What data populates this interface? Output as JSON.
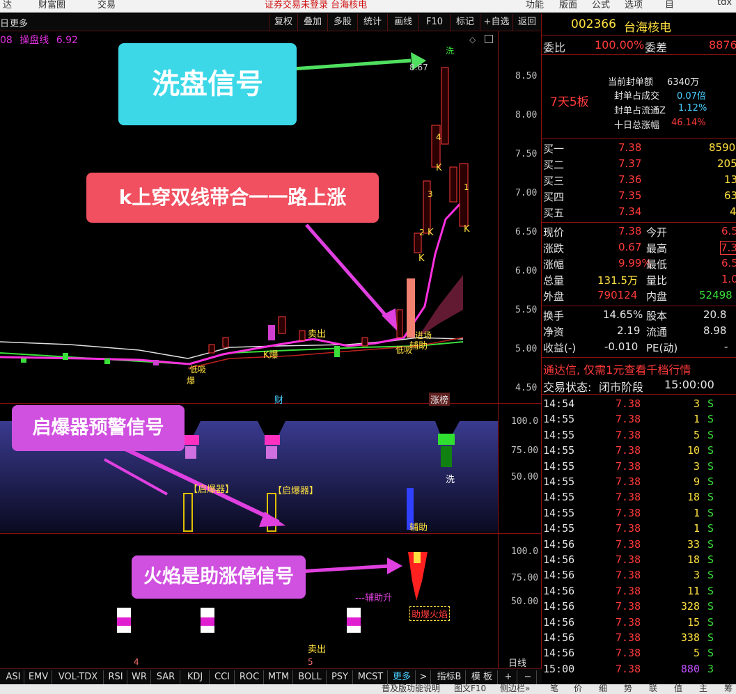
{
  "topmenu": {
    "items": [
      "达",
      "财富圈",
      "交易"
    ],
    "notice": "证券交易未登录  台海核电",
    "right_items": [
      "功能",
      "版面",
      "公式",
      "选项",
      "目",
      "tdx"
    ]
  },
  "toolbar": {
    "period": "日",
    "more": "更多",
    "buttons": [
      "复权",
      "叠加",
      "多股",
      "统计",
      "画线",
      "F10",
      "标记",
      "+自选",
      "返回"
    ]
  },
  "indicator": {
    "code": "08",
    "name": "操盘线",
    "value": "6.92"
  },
  "price_axis": [
    "8.50",
    "8.00",
    "7.50",
    "7.00",
    "6.50",
    "6.00",
    "5.50",
    "5.00",
    "4.50"
  ],
  "panel2_axis": [
    "100.0",
    "75.00",
    "50.00"
  ],
  "panel3_axis": [
    "100.0",
    "75.00",
    "50.00"
  ],
  "callouts": {
    "wash": "洗盘信号",
    "k_cross": "k上穿双线带合一一路上涨",
    "detonator": "启爆器预警信号",
    "flame": "火焰是助涨停信号"
  },
  "chart_labels": {
    "peak": "8.67",
    "wash_top": "洗",
    "k": "K",
    "k_bao": "K爆",
    "low_suck_1": "低吸",
    "low_suck_2": "低吸",
    "enter": "进场",
    "assist": "辅助",
    "sell": "卖出",
    "bao": "爆",
    "cai": "财",
    "zhangbang": "涨榜",
    "wave_1": "1",
    "wave_2": "2",
    "wave_3": "3",
    "wave_4": "4",
    "detonator_1": "【启爆器】",
    "detonator_2": "【启爆器】",
    "wash_p2": "洗",
    "assist_p2": "辅助",
    "assist_up": "---辅助升",
    "flame": "助爆火焰",
    "sell_p3": "卖出",
    "day_4": "4",
    "day_5": "5",
    "day_line": "日线"
  },
  "stock": {
    "code": "002366",
    "name": "台海核电"
  },
  "weibi": {
    "label1": "委比",
    "value1": "100.00%",
    "label2": "委差",
    "value2": "8876"
  },
  "board": {
    "streak": "7天5板",
    "rows": [
      {
        "label": "当前封单额",
        "value": "6340万"
      },
      {
        "label": "封单占成交",
        "value": "0.07倍"
      },
      {
        "label": "封单占流通Z",
        "value": "1.12%"
      },
      {
        "label": "十日总涨幅",
        "value": "46.14%"
      }
    ]
  },
  "orderbook": [
    {
      "label": "买一",
      "price": "7.38",
      "vol": "8590"
    },
    {
      "label": "买二",
      "price": "7.37",
      "vol": "205"
    },
    {
      "label": "买三",
      "price": "7.36",
      "vol": "13"
    },
    {
      "label": "买四",
      "price": "7.35",
      "vol": "63"
    },
    {
      "label": "买五",
      "price": "7.34",
      "vol": "4"
    }
  ],
  "quote": [
    {
      "l1": "现价",
      "v1": "7.38",
      "l2": "今开",
      "v2": "6.5"
    },
    {
      "l1": "涨跌",
      "v1": "0.67",
      "l2": "最高",
      "v2": "7.3"
    },
    {
      "l1": "涨幅",
      "v1": "9.99%",
      "l2": "最低",
      "v2": "6.5"
    },
    {
      "l1": "总量",
      "v1": "131.5万",
      "l2": "量比",
      "v2": "1.0"
    },
    {
      "l1": "外盘",
      "v1": "790124",
      "l2": "内盘",
      "v2": "52498"
    }
  ],
  "fundamentals": [
    {
      "l1": "换手",
      "v1": "14.65%",
      "l2": "股本",
      "v2": "20.8"
    },
    {
      "l1": "净资",
      "v1": "2.19",
      "l2": "流通",
      "v2": "8.98"
    },
    {
      "l1": "收益(-)",
      "v1": "-0.010",
      "l2": "PE(动)",
      "v2": "-"
    }
  ],
  "promo": "通达信, 仅需1元查看千档行情",
  "trade_status": {
    "label": "交易状态:",
    "value": "闭市阶段",
    "time": "15:00:00"
  },
  "ticks": [
    {
      "t": "14:54",
      "p": "7.38",
      "v": "3",
      "s": "S"
    },
    {
      "t": "14:55",
      "p": "7.38",
      "v": "1",
      "s": "S"
    },
    {
      "t": "14:55",
      "p": "7.38",
      "v": "5",
      "s": "S"
    },
    {
      "t": "14:55",
      "p": "7.38",
      "v": "10",
      "s": "S"
    },
    {
      "t": "14:55",
      "p": "7.38",
      "v": "3",
      "s": "S"
    },
    {
      "t": "14:55",
      "p": "7.38",
      "v": "9",
      "s": "S"
    },
    {
      "t": "14:55",
      "p": "7.38",
      "v": "18",
      "s": "S"
    },
    {
      "t": "14:55",
      "p": "7.38",
      "v": "1",
      "s": "S"
    },
    {
      "t": "14:55",
      "p": "7.38",
      "v": "1",
      "s": "S"
    },
    {
      "t": "14:56",
      "p": "7.38",
      "v": "33",
      "s": "S"
    },
    {
      "t": "14:56",
      "p": "7.38",
      "v": "18",
      "s": "S"
    },
    {
      "t": "14:56",
      "p": "7.38",
      "v": "3",
      "s": "S"
    },
    {
      "t": "14:56",
      "p": "7.38",
      "v": "11",
      "s": "S"
    },
    {
      "t": "14:56",
      "p": "7.38",
      "v": "328",
      "s": "S"
    },
    {
      "t": "14:56",
      "p": "7.38",
      "v": "15",
      "s": "S"
    },
    {
      "t": "14:56",
      "p": "7.38",
      "v": "338",
      "s": "S"
    },
    {
      "t": "14:56",
      "p": "7.38",
      "v": "5",
      "s": "S"
    },
    {
      "t": "15:00",
      "p": "7.38",
      "v": "880",
      "s": "3"
    }
  ],
  "bottom_tabs": [
    "ASI",
    "EMV",
    "VOL-TDX",
    "RSI",
    "WR",
    "SAR",
    "KDJ",
    "CCI",
    "ROC",
    "MTM",
    "BOLL",
    "PSY",
    "MCST",
    "更多",
    ">",
    "指标B",
    "模 板",
    "+",
    "−"
  ],
  "statusbar": {
    "left": "普及版功能说明",
    "mid": "图文F10",
    "mid2": "侧边栏»",
    "right_tabs": [
      "笔",
      "价",
      "细",
      "势",
      "联",
      "值",
      "主",
      "筹"
    ]
  },
  "colors": {
    "up": "#ff3a3a",
    "down": "#3adf3a",
    "accent_line": "#e030e0",
    "callout_cyan": "#3cd8e8",
    "callout_red": "#f05060",
    "callout_purple": "#d050e0"
  }
}
